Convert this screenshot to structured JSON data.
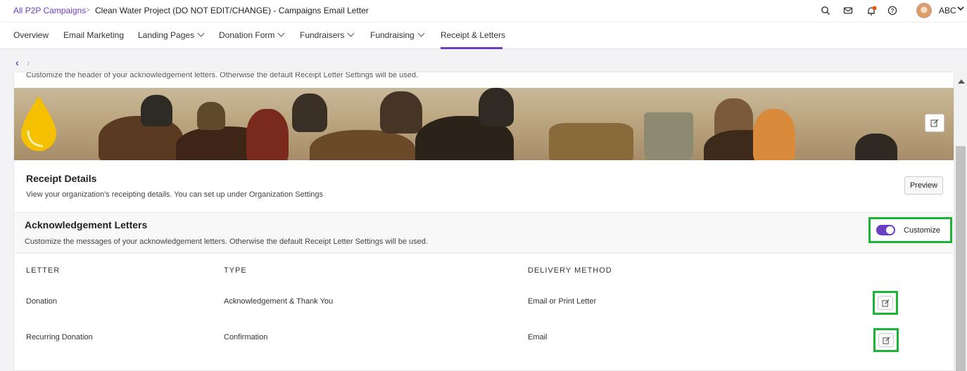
{
  "breadcrumb": {
    "parent": "All P2P Campaigns",
    "separator": ">",
    "current": "Clean Water Project (DO NOT EDIT/CHANGE) - Campaigns Email Letter"
  },
  "user": {
    "name": "ABC"
  },
  "tabs": [
    {
      "label": "Overview"
    },
    {
      "label": "Email Marketing"
    },
    {
      "label": "Landing Pages"
    },
    {
      "label": "Donation Form"
    },
    {
      "label": "Fundraisers"
    },
    {
      "label": "Fundraising"
    },
    {
      "label": "Receipt & Letters"
    }
  ],
  "active_tab": "Receipt & Letters",
  "pager": {
    "back": "‹",
    "forward": "›"
  },
  "header_section": {
    "cut_text": "Customize the header of your acknowledgement letters. Otherwise the default Receipt Letter Settings will be used."
  },
  "receipt_details": {
    "title": "Receipt Details",
    "description": "View your organization's receipting details. You can set up under Organization Settings",
    "preview_label": "Preview"
  },
  "ack_letters": {
    "title": "Acknowledgement Letters",
    "description": "Customize the messages of your acknowledgement letters. Otherwise the default Receipt Letter Settings will be used.",
    "customize_label": "Customize",
    "customize_on": true
  },
  "letters_table": {
    "headers": [
      "LETTER",
      "TYPE",
      "DELIVERY METHOD"
    ],
    "rows": [
      {
        "letter": "Donation",
        "type": "Acknowledgement & Thank You",
        "delivery": "Email or Print Letter"
      },
      {
        "letter": "Recurring Donation",
        "type": "Confirmation",
        "delivery": "Email"
      }
    ]
  },
  "colors": {
    "accent": "#6a3fc4",
    "highlight": "#1db335",
    "drop": "#f5c000"
  },
  "icons": [
    "search-icon",
    "mail-icon",
    "bell-icon",
    "help-icon",
    "chevron-down-icon",
    "edit-icon"
  ]
}
